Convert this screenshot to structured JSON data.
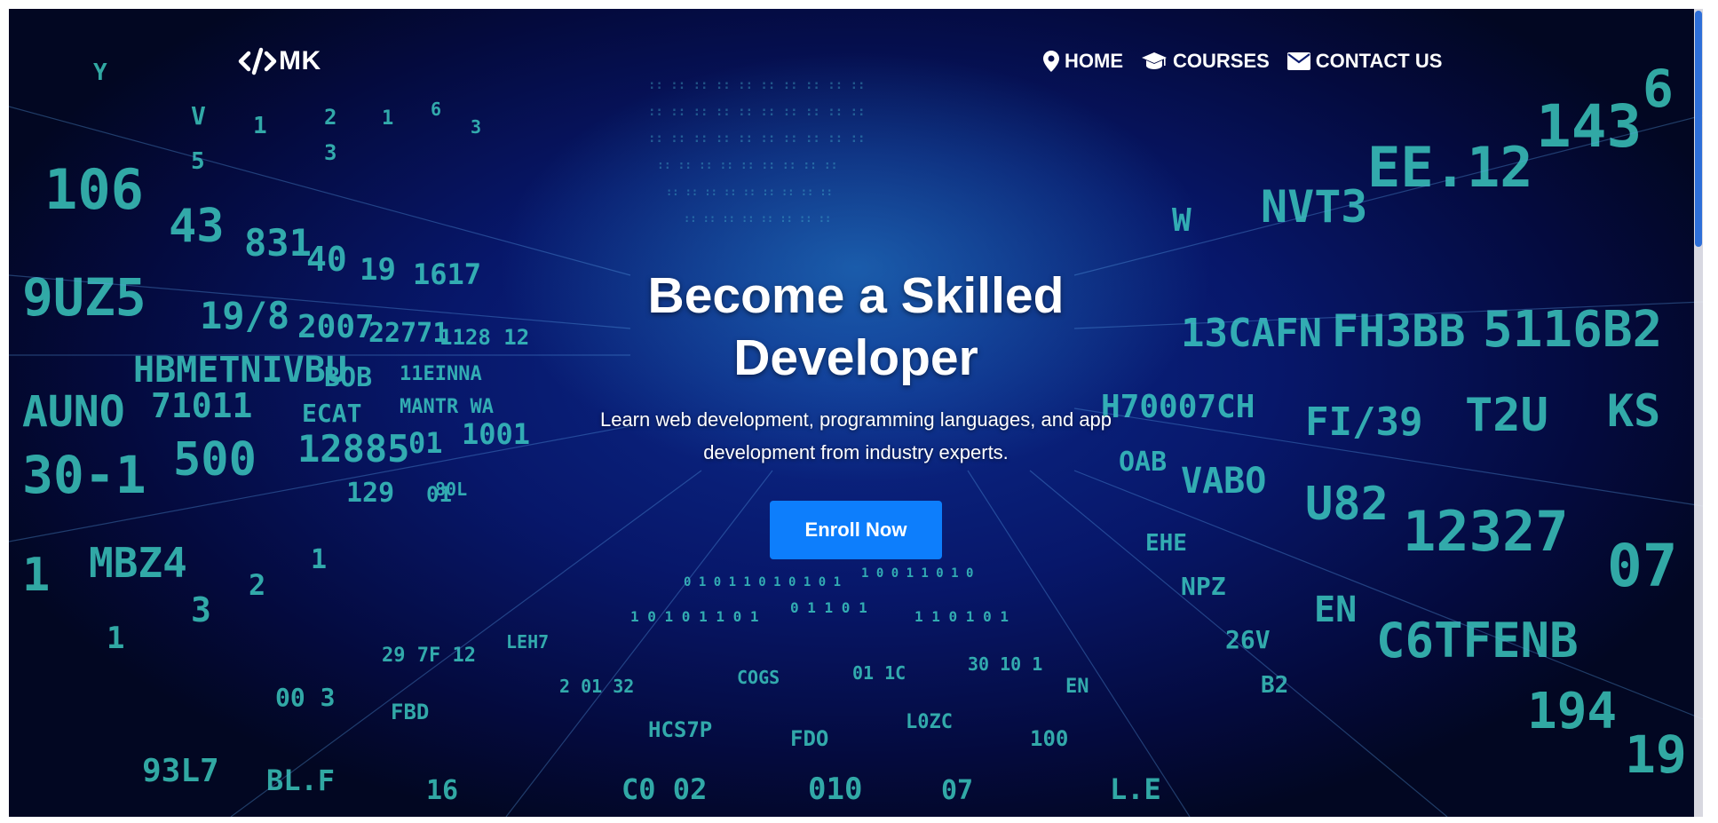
{
  "brand": {
    "logo_text": "MK",
    "logo_icon": "code-icon"
  },
  "nav": {
    "items": [
      {
        "label": "HOME",
        "icon": "map-marker-icon"
      },
      {
        "label": "COURSES",
        "icon": "graduation-cap-icon"
      },
      {
        "label": "CONTACT US",
        "icon": "envelope-icon"
      }
    ]
  },
  "hero": {
    "title": "Become a Skilled Developer",
    "subtitle": "Learn web development, programming languages, and app development from industry experts.",
    "cta_label": "Enroll Now"
  },
  "colors": {
    "primary_button": "#0d7efc",
    "background_dark": "#040a3d",
    "digits_glow": "#3fd6c8",
    "text": "#ffffff"
  }
}
